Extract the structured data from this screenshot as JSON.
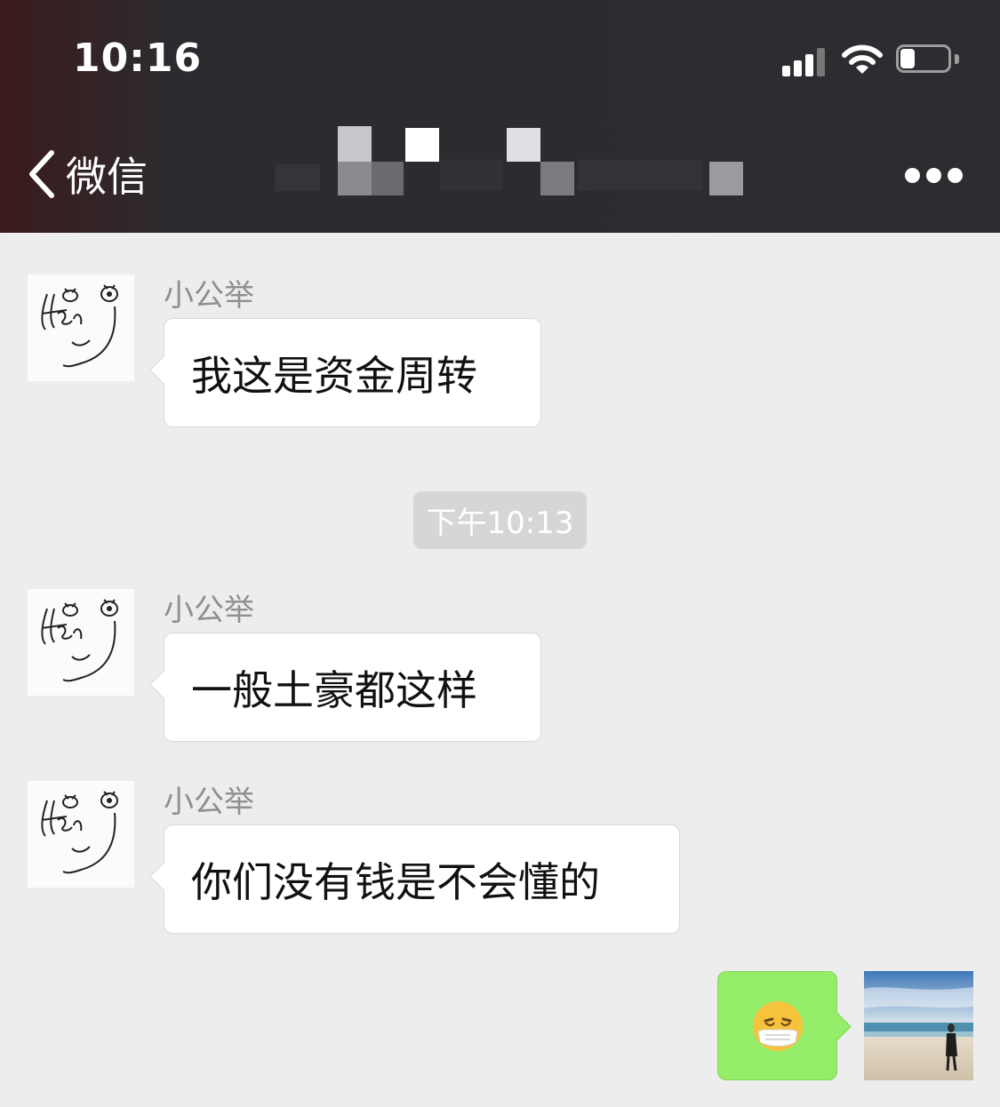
{
  "status_bar": {
    "time": "10:16",
    "battery_level": 0.3
  },
  "nav": {
    "back_label": "微信",
    "more_icon": "more-dots-icon"
  },
  "messages": [
    {
      "sender": "小公举",
      "text": "我这是资金周转"
    },
    {
      "sender": "小公举",
      "text": "一般土豪都这样"
    },
    {
      "sender": "小公举",
      "text": "你们没有钱是不会懂的"
    }
  ],
  "timestamp": "下午10:13",
  "my_message": {
    "content": "face-with-medical-mask-emoji"
  },
  "colors": {
    "header_bg": "#2d2d31",
    "chat_bg": "#ededed",
    "my_bubble": "#95ec69",
    "other_bubble": "#ffffff"
  }
}
